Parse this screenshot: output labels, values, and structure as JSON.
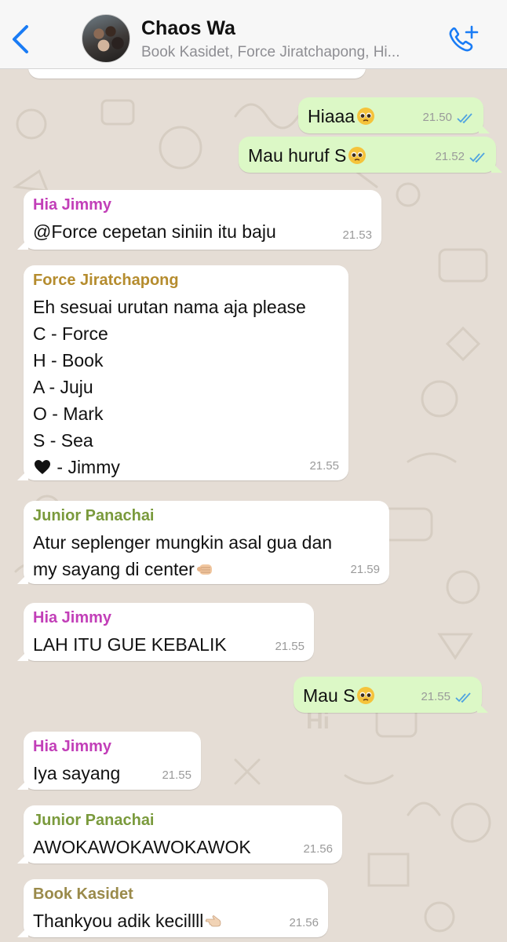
{
  "header": {
    "back_icon": "chevron-left-icon",
    "title": "Chaos Wa",
    "subtitle": "Book Kasidet, Force Jiratchapong, Hi...",
    "call_icon": "add-call-icon",
    "accent": "#1a7cf5"
  },
  "colors": {
    "incoming": "#ffffff",
    "outgoing": "#dcf8c6",
    "wallpaper": "#e5ddd5",
    "read_ticks": "#4fa3e0"
  },
  "messages": [
    {
      "dir": "out",
      "text": "Hiaaa",
      "emoji": "pleading-face",
      "time": "21.50"
    },
    {
      "dir": "out",
      "text": "Mau huruf S",
      "emoji": "pleading-face",
      "time": "21.52"
    },
    {
      "dir": "in",
      "sender": "Hia Jimmy",
      "sender_color": "#c23fb8",
      "text": "@Force cepetan siniin itu baju",
      "time": "21.53"
    },
    {
      "dir": "in",
      "sender": "Force Jiratchapong",
      "sender_color": "#b58c2e",
      "lines": [
        "Eh sesuai urutan nama aja please",
        "C - Force",
        "H - Book",
        "A - Juju",
        "O - Mark",
        "S - Sea"
      ],
      "last_line_emoji": "black-heart",
      "last_line": " - Jimmy",
      "time": "21.55"
    },
    {
      "dir": "in",
      "sender": "Junior Panachai",
      "sender_color": "#7a9a3c",
      "lines": [
        "Atur seplenger mungkin asal gua dan"
      ],
      "last_line": "my sayang di center",
      "last_line_emoji_after": "pointing-fist",
      "time": "21.59"
    },
    {
      "dir": "in",
      "sender": "Hia Jimmy",
      "sender_color": "#c23fb8",
      "text": "LAH ITU GUE KEBALIK",
      "time": "21.55"
    },
    {
      "dir": "out",
      "text": "Mau S",
      "emoji": "pleading-face",
      "time": "21.55"
    },
    {
      "dir": "in",
      "sender": "Hia Jimmy",
      "sender_color": "#c23fb8",
      "text": "Iya sayang",
      "time": "21.55"
    },
    {
      "dir": "in",
      "sender": "Junior Panachai",
      "sender_color": "#7a9a3c",
      "text": "AWOKAWOKAWOKAWOK",
      "time": "21.56"
    },
    {
      "dir": "in",
      "sender": "Book Kasidet",
      "sender_color": "#9a8a4a",
      "text": "Thankyou adik kecillll",
      "emoji": "pointing-hand",
      "time": "21.56"
    }
  ]
}
